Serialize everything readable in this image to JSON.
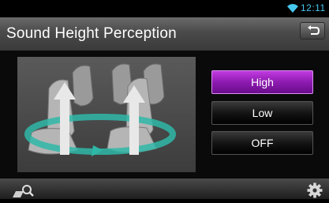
{
  "status": {
    "time": "12:11",
    "wifi_icon": "wifi-icon",
    "accent": "#46c8ee"
  },
  "header": {
    "title": "Sound Height Perception",
    "back_icon": "back-arrow-icon"
  },
  "options": [
    {
      "label": "High",
      "selected": true
    },
    {
      "label": "Low",
      "selected": false
    },
    {
      "label": "OFF",
      "selected": false
    }
  ],
  "colors": {
    "selected": "#9b22c4",
    "ring": "#2fb8a8",
    "arrow": "#e8e8e8"
  },
  "footer": {
    "search_icon": "search-icon",
    "settings_icon": "gear-icon"
  }
}
